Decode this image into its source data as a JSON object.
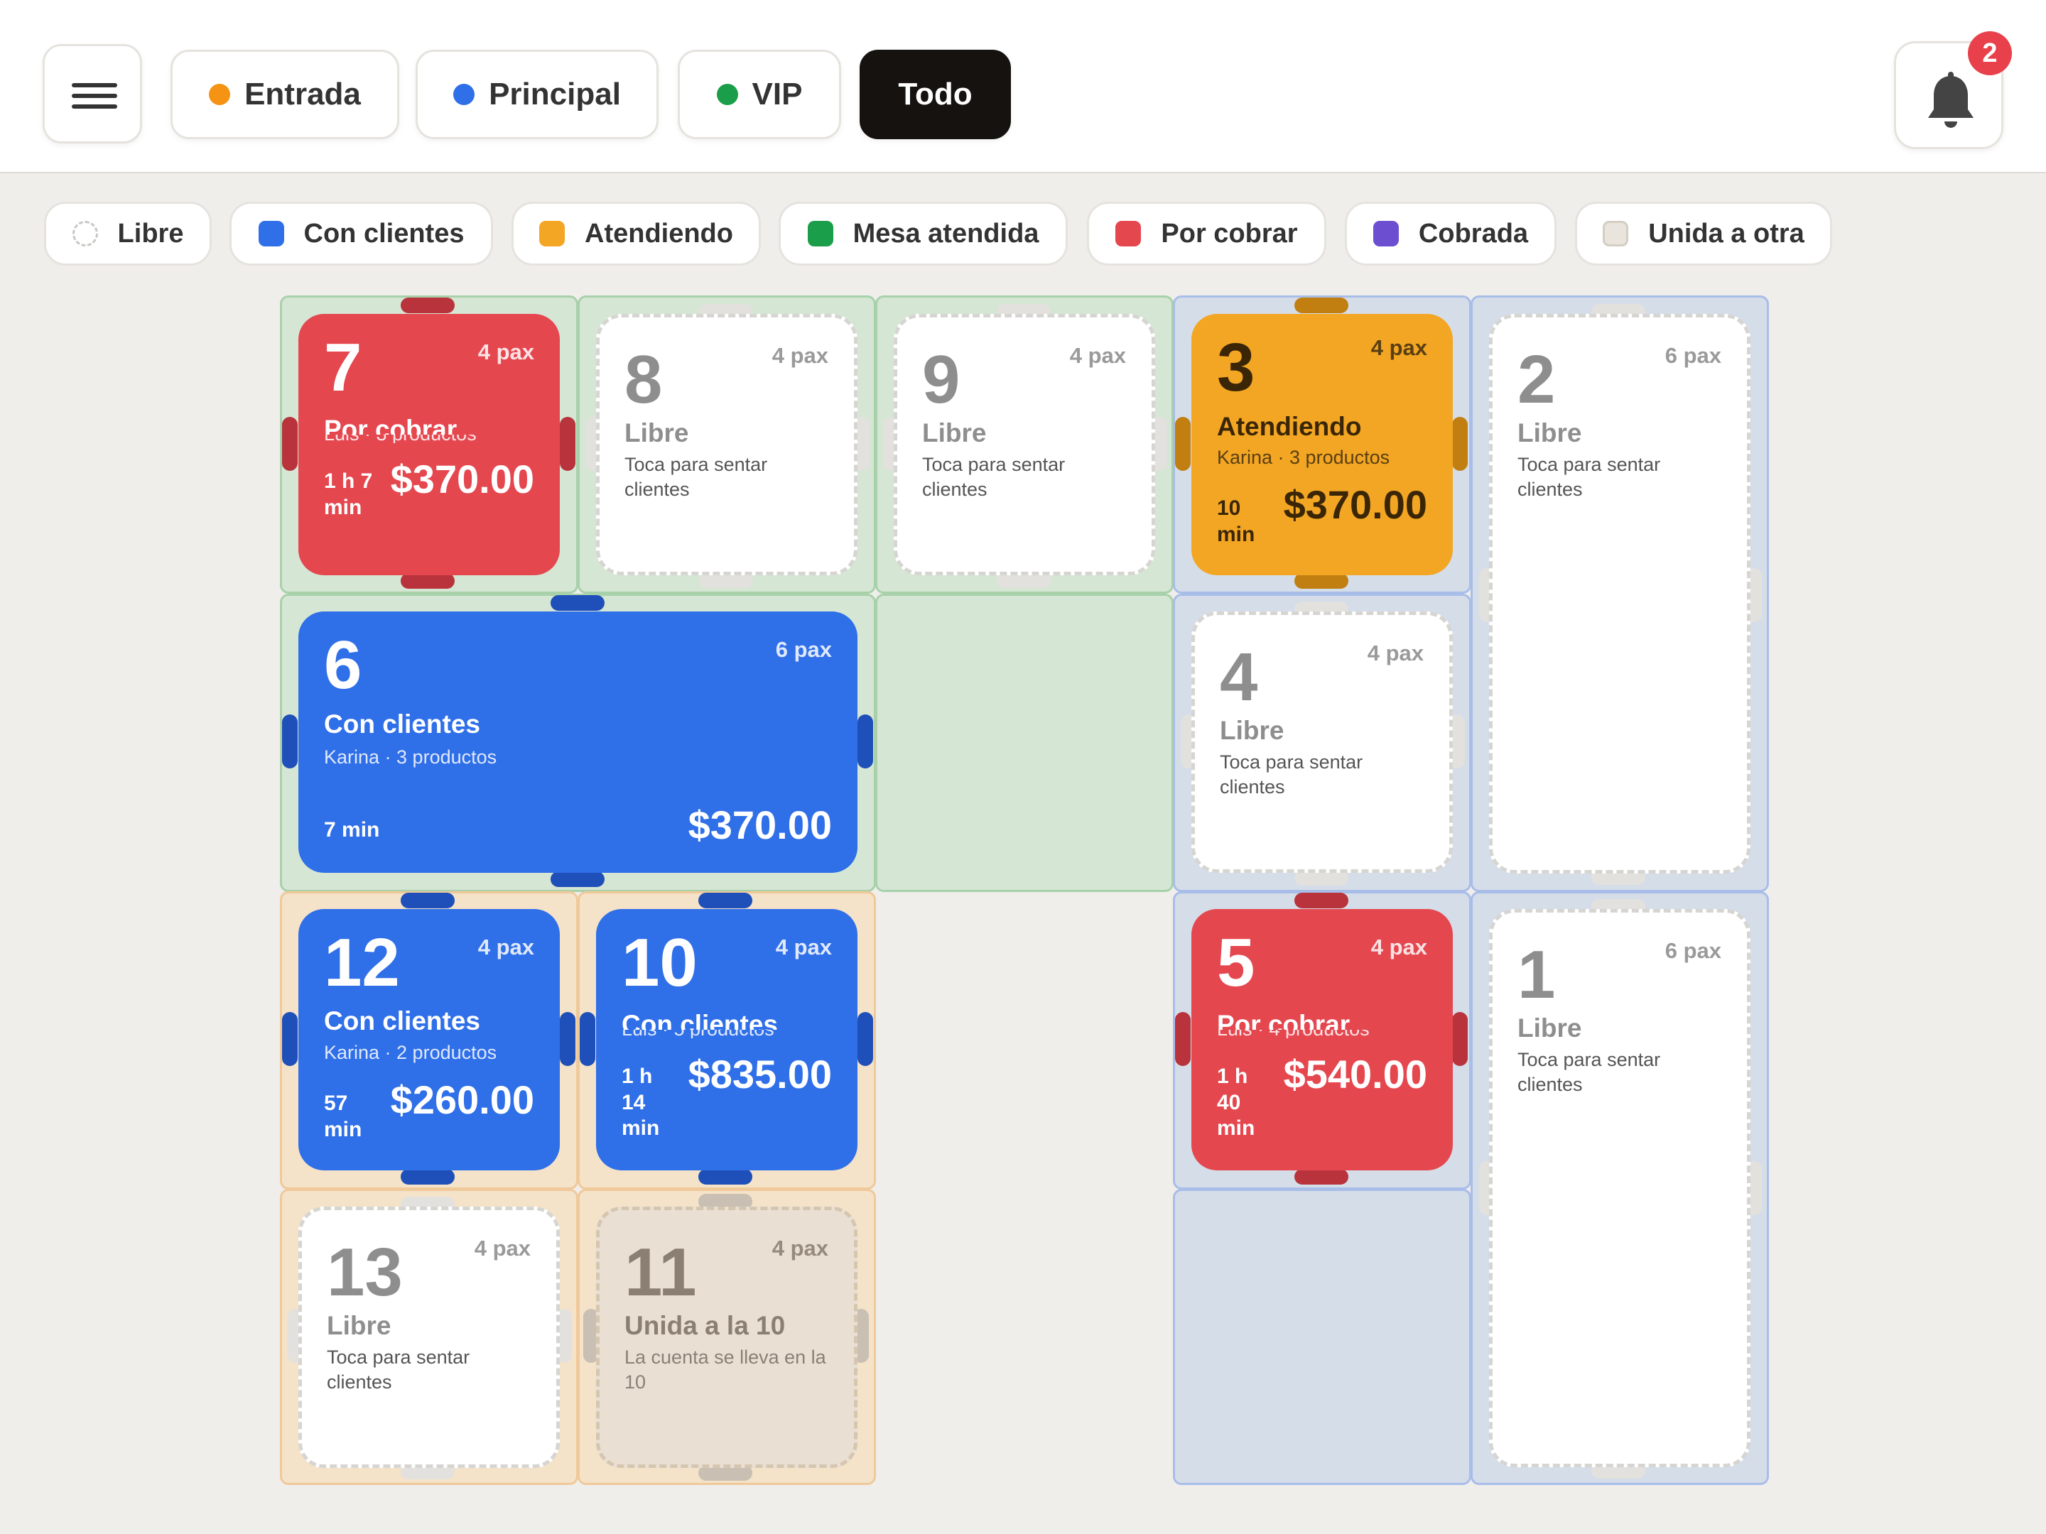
{
  "header": {
    "zones": [
      {
        "label": "Entrada",
        "color": "#f49314"
      },
      {
        "label": "Principal",
        "color": "#2f6fe8"
      },
      {
        "label": "VIP",
        "color": "#1b9e49"
      },
      {
        "label": "Todo",
        "active": true
      }
    ],
    "notifications_count": "2"
  },
  "legend": [
    {
      "label": "Libre",
      "color": "#ffffff"
    },
    {
      "label": "Con clientes",
      "color": "#2f6fe8"
    },
    {
      "label": "Atendiendo",
      "color": "#f3a623"
    },
    {
      "label": "Mesa atendida",
      "color": "#1b9e49"
    },
    {
      "label": "Por cobrar",
      "color": "#e5474f"
    },
    {
      "label": "Cobrada",
      "color": "#6b4fd0"
    },
    {
      "label": "Unida a otra",
      "color": "#e9e4dc"
    }
  ],
  "tables": {
    "t7": {
      "number": "7",
      "pax": "4 pax",
      "status": "Por cobrar",
      "sub": "Luis · 3 productos",
      "time": "1 h 7 min",
      "amount": "$370.00"
    },
    "t8": {
      "number": "8",
      "pax": "4 pax",
      "status": "Libre",
      "sub": "Toca para sentar clientes"
    },
    "t9": {
      "number": "9",
      "pax": "4 pax",
      "status": "Libre",
      "sub": "Toca para sentar clientes"
    },
    "t3": {
      "number": "3",
      "pax": "4 pax",
      "status": "Atendiendo",
      "sub": "Karina · 3 productos",
      "time": "10 min",
      "amount": "$370.00"
    },
    "t2": {
      "number": "2",
      "pax": "6 pax",
      "status": "Libre",
      "sub": "Toca para sentar clientes"
    },
    "t6": {
      "number": "6",
      "pax": "6 pax",
      "status": "Con clientes",
      "sub": "Karina · 3 productos",
      "time": "7 min",
      "amount": "$370.00"
    },
    "t4": {
      "number": "4",
      "pax": "4 pax",
      "status": "Libre",
      "sub": "Toca para sentar clientes"
    },
    "t12": {
      "number": "12",
      "pax": "4 pax",
      "status": "Con clientes",
      "sub": "Karina · 2 productos",
      "time": "57 min",
      "amount": "$260.00"
    },
    "t10": {
      "number": "10",
      "pax": "4 pax",
      "status": "Con clientes",
      "sub": "Luis · 5 productos",
      "time": "1 h 14 min",
      "amount": "$835.00"
    },
    "t5": {
      "number": "5",
      "pax": "4 pax",
      "status": "Por cobrar",
      "sub": "Luis · 4 productos",
      "time": "1 h 40 min",
      "amount": "$540.00"
    },
    "t1": {
      "number": "1",
      "pax": "6 pax",
      "status": "Libre",
      "sub": "Toca para sentar clientes"
    },
    "t13": {
      "number": "13",
      "pax": "4 pax",
      "status": "Libre",
      "sub": "Toca para sentar clientes"
    },
    "t11": {
      "number": "11",
      "pax": "4 pax",
      "status": "Unida a la 10",
      "sub": "La cuenta se lleva en la 10"
    }
  }
}
